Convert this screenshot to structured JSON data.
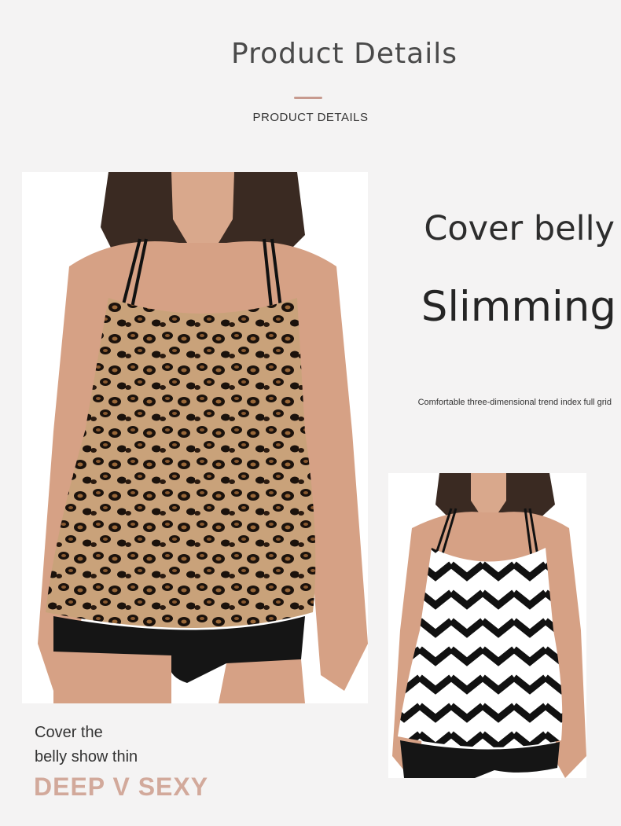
{
  "header": {
    "title": "Product Details",
    "subtitle": "PRODUCT DETAILS"
  },
  "feature": {
    "line1": "Cover belly",
    "line2": "Slimming",
    "tagline": "Comfortable three-dimensional trend index full grid"
  },
  "caption": {
    "line1": "Cover the",
    "line2": "belly show thin",
    "highlight": "DEEP V SEXY"
  },
  "colors": {
    "background": "#f4f3f3",
    "accent": "#c79a8f",
    "highlight_text": "#d2a99b"
  }
}
